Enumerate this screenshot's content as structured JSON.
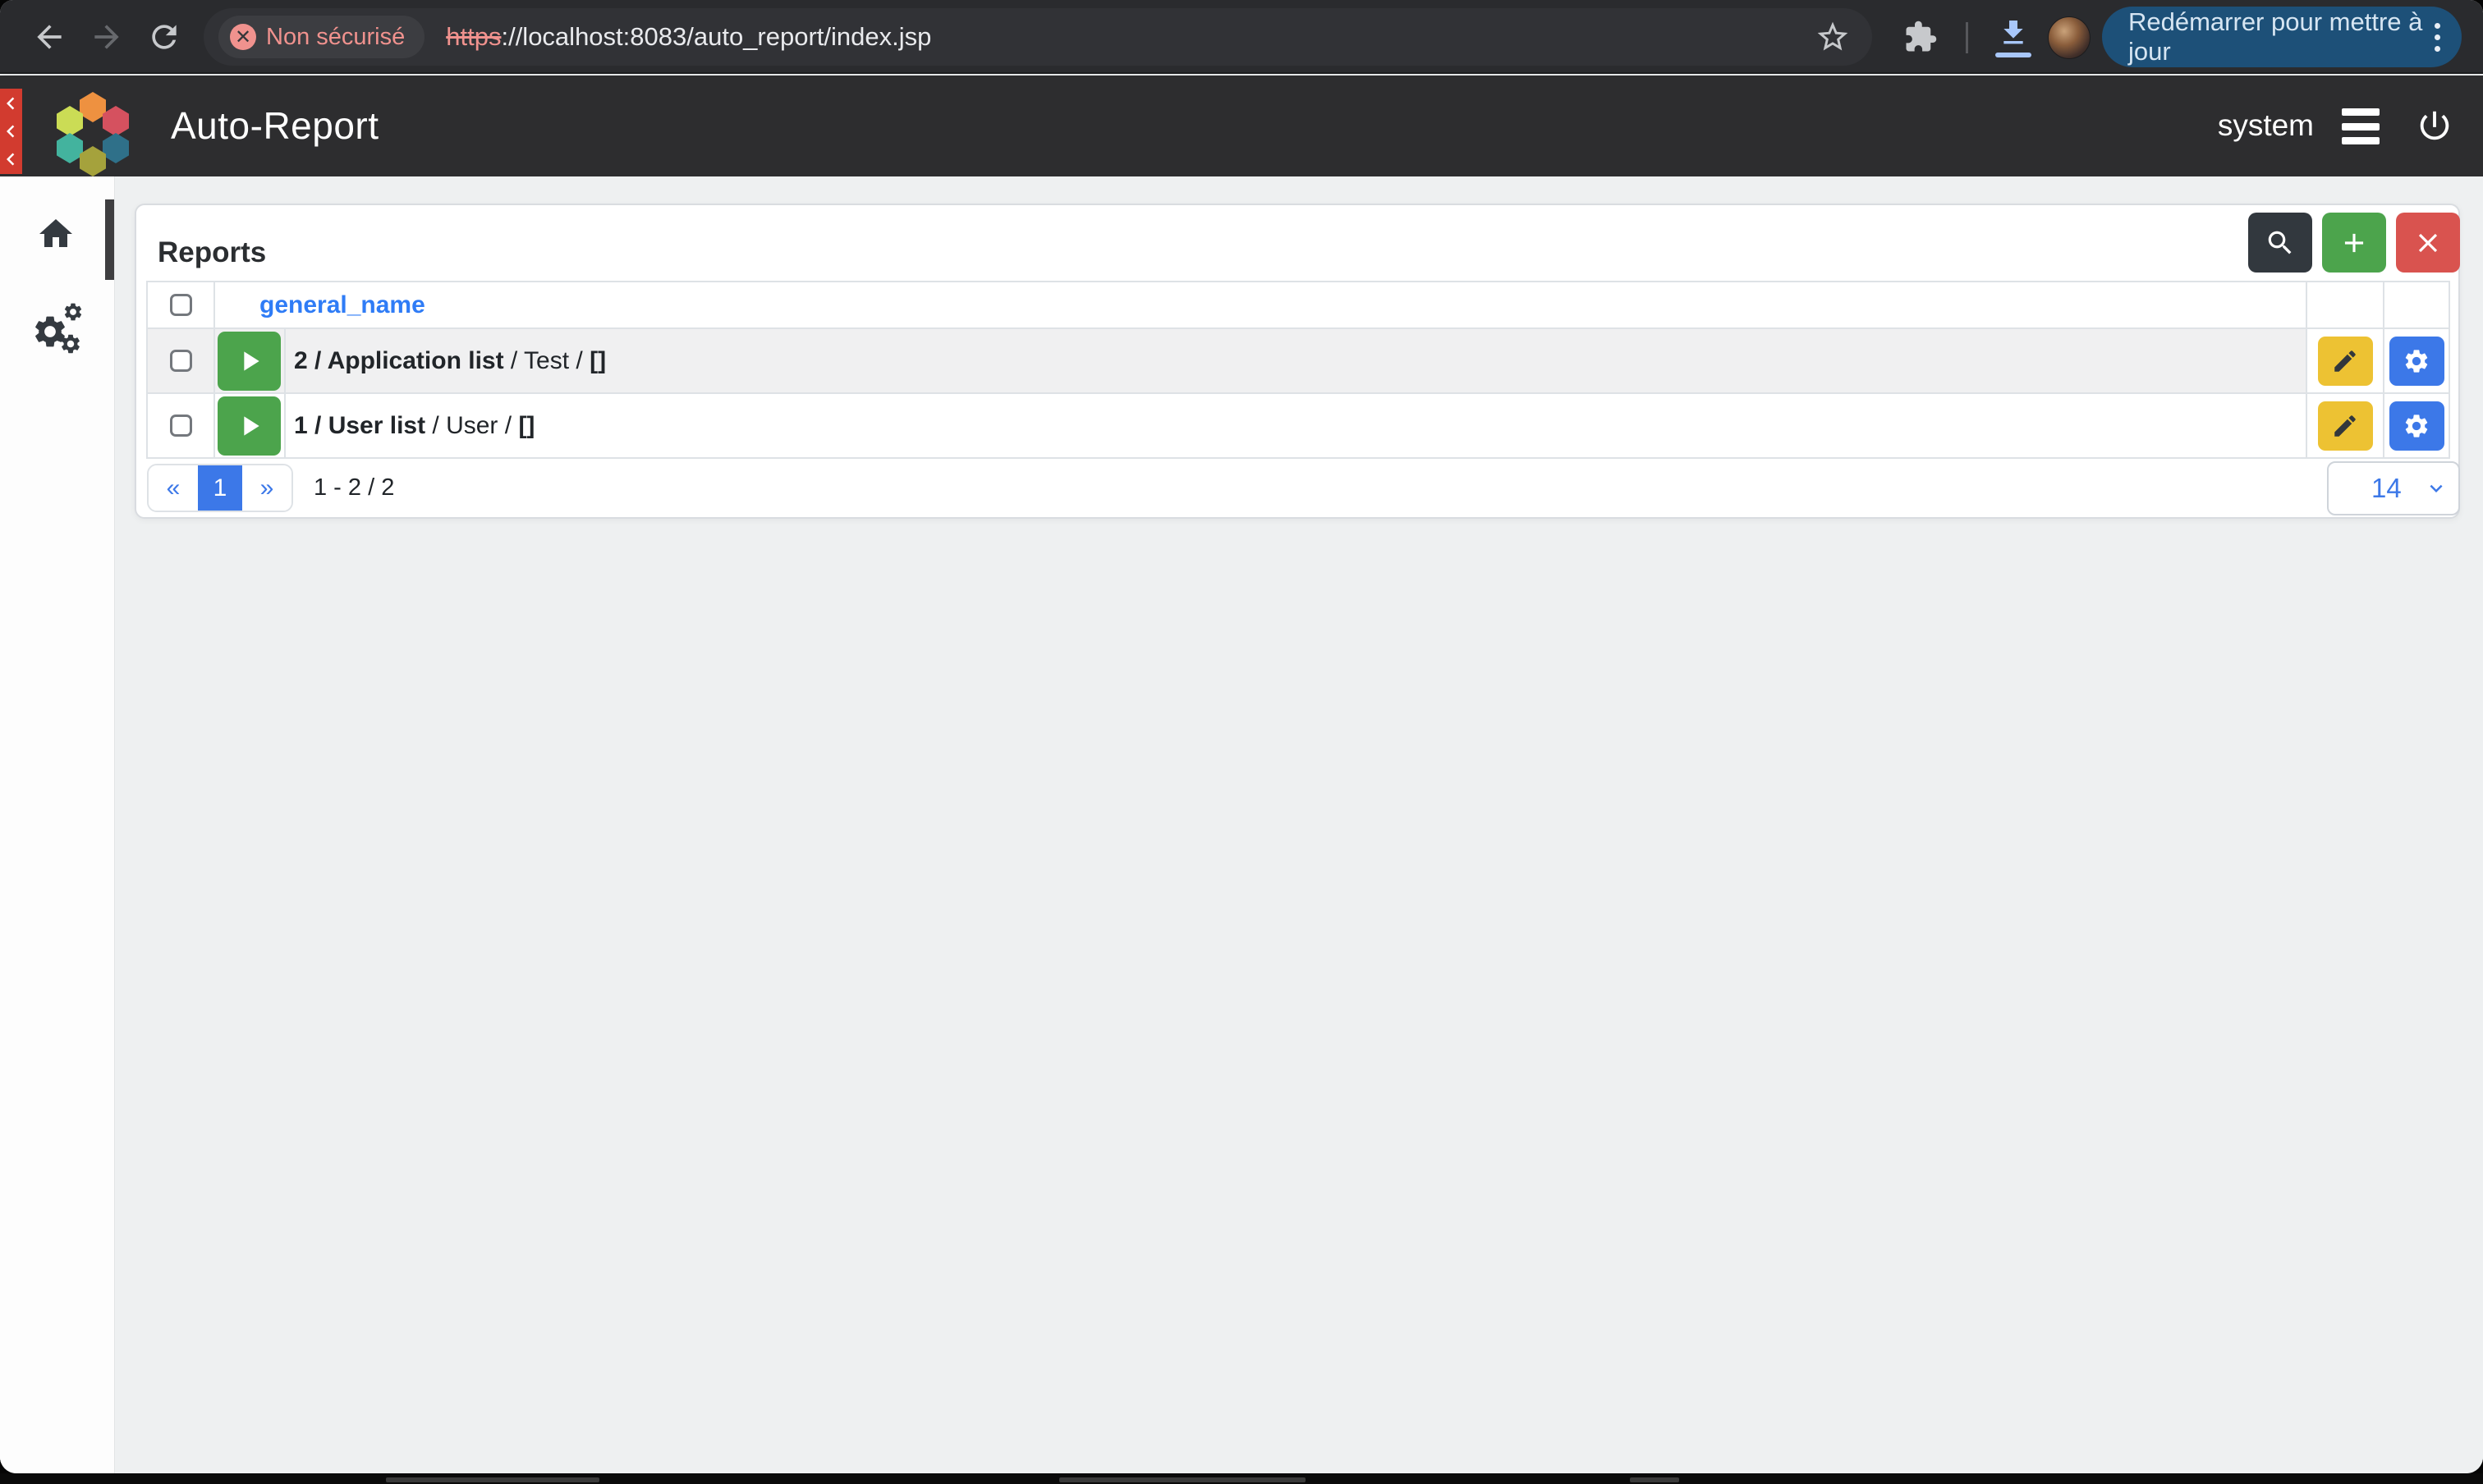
{
  "browser": {
    "security_badge": "Non sécurisé",
    "url_scheme": "https",
    "url_rest": "://localhost:8083/auto_report/index.jsp",
    "update_button": "Redémarrer pour mettre à jour"
  },
  "header": {
    "app_title": "Auto-Report",
    "username": "system"
  },
  "panel": {
    "title": "Reports",
    "table": {
      "name_column_header": "general_name",
      "rows": [
        {
          "bold": "2 / Application list",
          "normal": " / Test / ",
          "suffix": "[]"
        },
        {
          "bold": "1 / User list",
          "normal": " / User / ",
          "suffix": "[]"
        }
      ]
    },
    "pagination": {
      "prev": "«",
      "current": "1",
      "next": "»",
      "summary": "1 - 2 / 2",
      "page_size": "14"
    }
  },
  "icons": {
    "not_secure": "crossed-circle",
    "bookmark": "star",
    "extensions": "puzzle-piece",
    "download": "arrow-down-tray",
    "browser_menu": "kebab-dots",
    "collapse": "chevron-left-triple",
    "menu": "hamburger",
    "logout": "power",
    "home": "house",
    "admin": "cogs",
    "search": "magnifier",
    "add": "plus",
    "close": "x",
    "run": "play",
    "edit": "pencil",
    "configure": "gear",
    "select_caret": "chevron-down"
  },
  "colors": {
    "accent_blue": "#3c78e8",
    "link_blue": "#2f7cf6",
    "green": "#4ca44c",
    "red": "#d9534f",
    "yellow": "#edc233",
    "dark_button": "#32383e",
    "update_pill": "#1d5078",
    "red_strip": "#d23b2f",
    "security_pink": "#f0928e"
  }
}
